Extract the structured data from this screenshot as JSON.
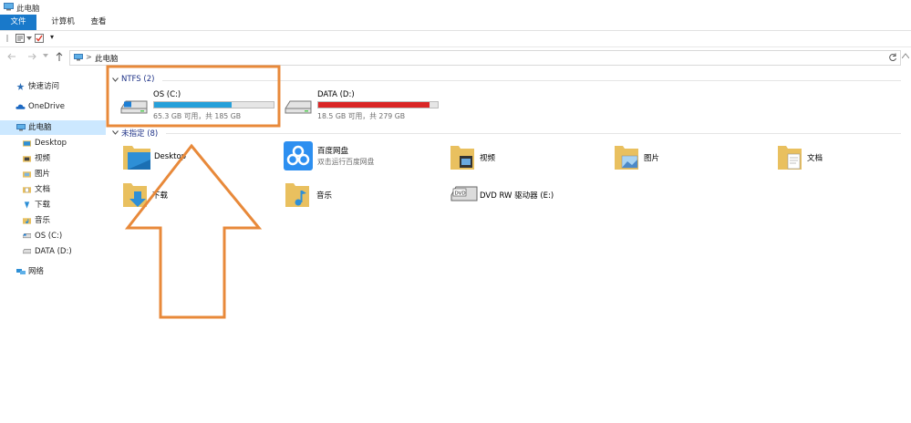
{
  "window": {
    "title": "此电脑"
  },
  "ribbon": {
    "tabs": [
      "文件",
      "计算机",
      "查看"
    ]
  },
  "qat": {
    "customize_glyph": "▾"
  },
  "address": {
    "chevron": ">",
    "path": "此电脑"
  },
  "sidebar": {
    "items": [
      {
        "label": "快速访问",
        "icon": "star-icon"
      },
      {
        "label": "OneDrive",
        "icon": "cloud-icon"
      },
      {
        "label": "此电脑",
        "icon": "pc-icon",
        "selected": true
      },
      {
        "label": "Desktop",
        "icon": "desktop-folder-icon"
      },
      {
        "label": "视频",
        "icon": "video-folder-icon"
      },
      {
        "label": "图片",
        "icon": "pictures-folder-icon"
      },
      {
        "label": "文档",
        "icon": "documents-folder-icon"
      },
      {
        "label": "下载",
        "icon": "downloads-folder-icon"
      },
      {
        "label": "音乐",
        "icon": "music-folder-icon"
      },
      {
        "label": "OS (C:)",
        "icon": "drive-icon"
      },
      {
        "label": "DATA (D:)",
        "icon": "drive-icon"
      },
      {
        "label": "网络",
        "icon": "network-icon"
      }
    ]
  },
  "groups": {
    "drives": {
      "header": "NTFS (2)",
      "items": [
        {
          "name": "OS (C:)",
          "size": "65.3 GB 可用，共 185 GB",
          "used_fraction": 0.647,
          "bar_color": "#26a0da"
        },
        {
          "name": "DATA (D:)",
          "size": "18.5 GB 可用，共 279 GB",
          "used_fraction": 0.934,
          "bar_color": "#da2626"
        }
      ]
    },
    "other": {
      "header": "未指定 (8)",
      "items": [
        {
          "name": "Desktop"
        },
        {
          "name": "百度网盘",
          "sub": "双击运行百度网盘"
        },
        {
          "name": "视频"
        },
        {
          "name": "图片"
        },
        {
          "name": "文档"
        },
        {
          "name": "下载"
        },
        {
          "name": "音乐"
        },
        {
          "name": "DVD RW 驱动器 (E:)"
        }
      ]
    }
  },
  "annotation": {
    "color": "#e8893a"
  }
}
